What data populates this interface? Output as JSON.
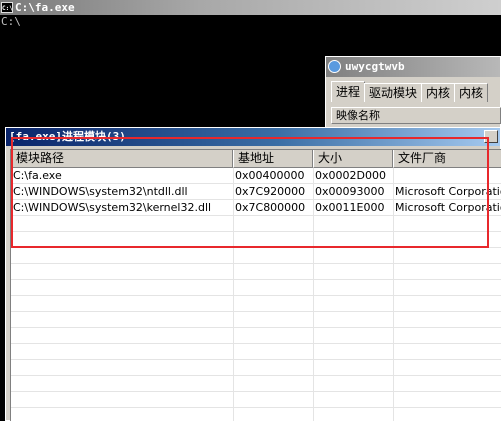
{
  "console": {
    "title": "C:\\fa.exe",
    "icon_label": "C:\\",
    "prompt": "C:\\"
  },
  "tool_window": {
    "title": "uwycgtwvb",
    "tabs": [
      {
        "label": "进程"
      },
      {
        "label": "驱动模块"
      },
      {
        "label": "内核"
      },
      {
        "label": "内核"
      }
    ],
    "column_header": "映像名称"
  },
  "module_dialog": {
    "title": "[fa.exe]进程模块(3)",
    "columns": [
      "模块路径",
      "基地址",
      "大小",
      "文件厂商"
    ],
    "rows": [
      {
        "path": "C:\\fa.exe",
        "base": "0x00400000",
        "size": "0x0002D000",
        "vendor": ""
      },
      {
        "path": "C:\\WINDOWS\\system32\\ntdll.dll",
        "base": "0x7C920000",
        "size": "0x00093000",
        "vendor": "Microsoft Corporation"
      },
      {
        "path": "C:\\WINDOWS\\system32\\kernel32.dll",
        "base": "0x7C800000",
        "size": "0x0011E000",
        "vendor": "Microsoft Corporation"
      }
    ]
  },
  "colors": {
    "highlight": "#e8282c",
    "active_title": "#0a246a",
    "inactive_title": "#808080",
    "face": "#d4d0c8"
  }
}
